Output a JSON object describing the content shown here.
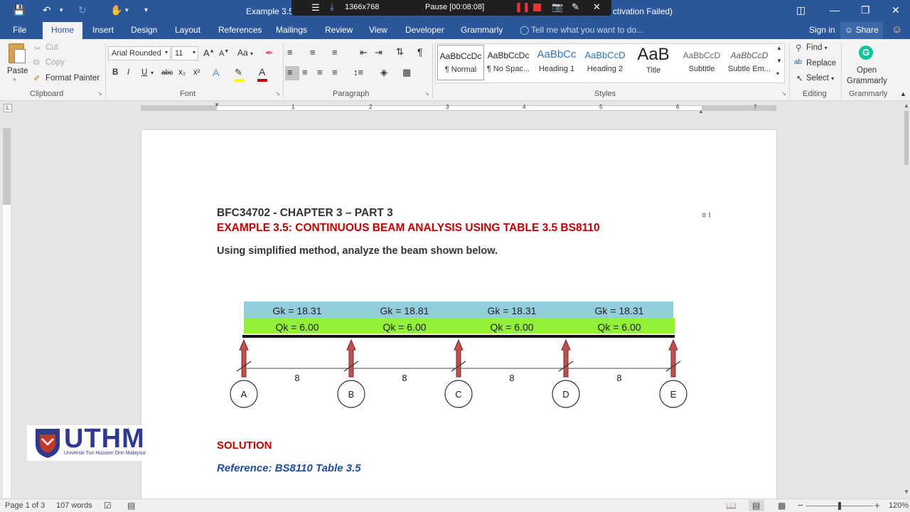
{
  "app": {
    "title": "Example 3.5 - C",
    "title_suffix": "ctivation Failed)",
    "recorder": {
      "resolution": "1366x768",
      "pause_label": "Pause [00:08:08]"
    }
  },
  "tabs": [
    "File",
    "Home",
    "Insert",
    "Design",
    "Layout",
    "References",
    "Mailings",
    "Review",
    "View",
    "Developer",
    "Grammarly"
  ],
  "tell_me": "Tell me what you want to do...",
  "sign_in": "Sign in",
  "share": "Share",
  "clipboard": {
    "paste": "Paste",
    "cut": "Cut",
    "copy": "Copy",
    "format_painter": "Format Painter",
    "label": "Clipboard"
  },
  "font": {
    "name": "Arial Rounded",
    "size": "11",
    "label": "Font",
    "bold": "B",
    "italic": "I",
    "underline": "U",
    "strike": "abc",
    "sub": "x₂",
    "sup": "x²",
    "grow": "A",
    "shrink": "A",
    "case": "Aa"
  },
  "paragraph": {
    "label": "Paragraph",
    "pilcrow": "¶"
  },
  "styles": {
    "label": "Styles",
    "items": [
      {
        "sample": "AaBbCcDc",
        "name": "¶ Normal"
      },
      {
        "sample": "AaBbCcDc",
        "name": "¶ No Spac..."
      },
      {
        "sample": "AaBbCc",
        "name": "Heading 1"
      },
      {
        "sample": "AaBbCcD",
        "name": "Heading 2"
      },
      {
        "sample": "AaB",
        "name": "Title"
      },
      {
        "sample": "AaBbCcD",
        "name": "Subtitle"
      },
      {
        "sample": "AaBbCcD",
        "name": "Subtle Em..."
      }
    ]
  },
  "editing": {
    "find": "Find",
    "replace": "Replace",
    "select": "Select",
    "label": "Editing"
  },
  "grammarly": {
    "open": "Open",
    "name": "Grammarly",
    "label": "Grammarly"
  },
  "ruler_numbers": [
    "1",
    "2",
    "3",
    "4",
    "5",
    "6",
    "7"
  ],
  "document": {
    "line1": "BFC34702 - CHAPTER 3 – PART 3",
    "line2": "EXAMPLE 3.5: CONTINUOUS BEAM ANALYSIS USING TABLE 3.5 BS8110",
    "line3": "Using simplified method, analyze the beam shown below.",
    "beam": {
      "gk": [
        "Gk = 18.31",
        "Gk = 18.81",
        "Gk = 18.31",
        "Gk = 18.31"
      ],
      "qk": [
        "Qk = 6.00",
        "Qk = 6.00",
        "Qk = 6.00",
        "Qk = 6.00"
      ],
      "spans": [
        "8",
        "8",
        "8",
        "8"
      ],
      "supports": [
        "A",
        "B",
        "C",
        "D",
        "E"
      ],
      "colors": {
        "gk_band": "#92cddc",
        "qk_band": "#92f036",
        "arrow": "#c0504d"
      }
    },
    "solution": "SOLUTION",
    "reference": "Reference: BS8110 Table 3.5"
  },
  "logo": {
    "text": "UTHM",
    "sub": "Universiti Tun Hussein Onn Malaysia"
  },
  "status": {
    "page": "Page 1 of 3",
    "words": "107 words",
    "zoom": "120%"
  },
  "colors": {
    "accent": "#2b579a",
    "heading_red": "#c00000",
    "ref_blue": "#1f4e9a"
  }
}
